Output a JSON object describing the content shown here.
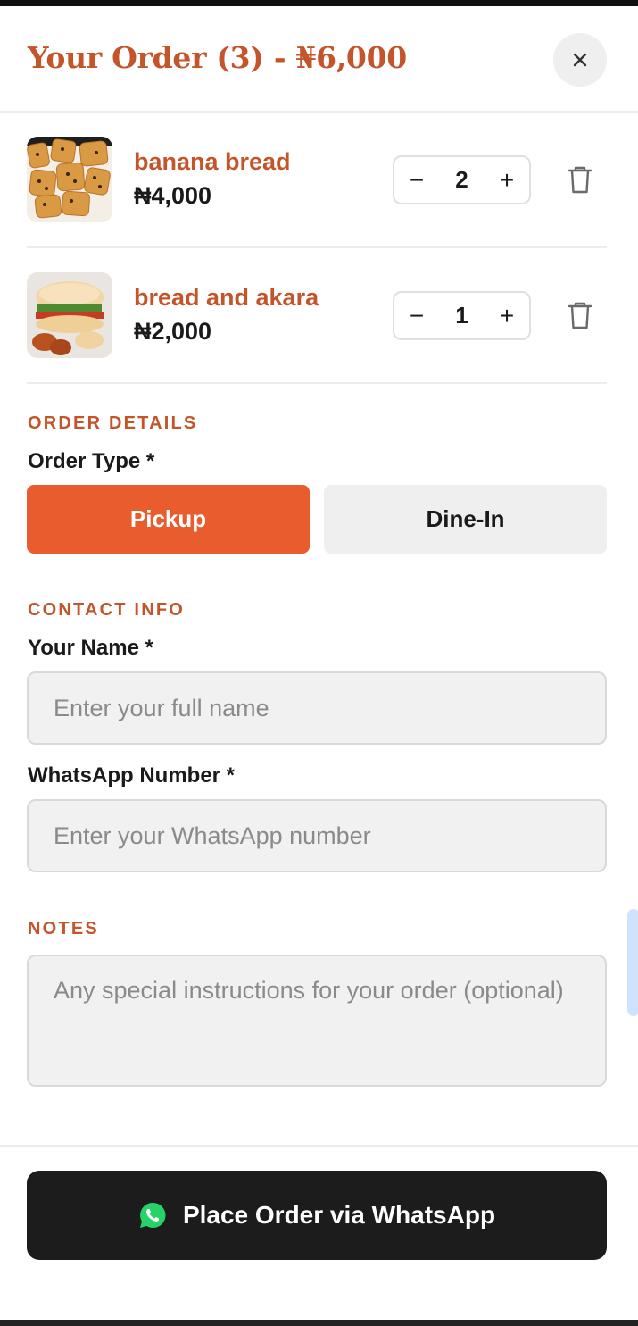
{
  "header": {
    "title": "Your Order (3) - ₦6,000",
    "close_icon": "close-icon"
  },
  "cart": {
    "items": [
      {
        "name": "banana bread",
        "price": "₦4,000",
        "quantity": "2",
        "minus": "−",
        "plus": "+",
        "image": "banana-bread-photo"
      },
      {
        "name": "bread and akara",
        "price": "₦2,000",
        "quantity": "1",
        "minus": "−",
        "plus": "+",
        "image": "bread-and-akara-photo"
      }
    ]
  },
  "order_details": {
    "section": "ORDER DETAILS",
    "order_type_label": "Order Type *",
    "options": [
      "Pickup",
      "Dine-In"
    ],
    "selected": "Pickup"
  },
  "contact": {
    "section": "CONTACT INFO",
    "name_label": "Your Name *",
    "name_placeholder": "Enter your full name",
    "name_value": "",
    "whatsapp_label": "WhatsApp Number *",
    "whatsapp_placeholder": "Enter your WhatsApp number",
    "whatsapp_value": ""
  },
  "notes": {
    "section": "NOTES",
    "placeholder": "Any special instructions for your order (optional)",
    "value": ""
  },
  "footer": {
    "place_order_label": "Place Order via WhatsApp",
    "icon": "whatsapp-icon"
  },
  "colors": {
    "accent": "#e85c2d",
    "heading": "#c4552a",
    "button_dark": "#1c1c1c",
    "whatsapp": "#25d366"
  }
}
